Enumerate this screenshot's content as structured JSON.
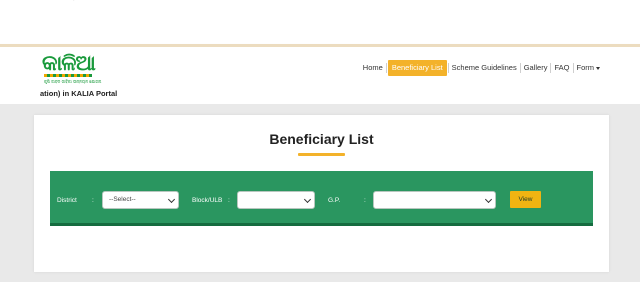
{
  "header": {
    "logo_text": "କାଳିଆ",
    "logo_tagline": "କୃଷି ଜୀବନ ଜୀବିକା ଉନ୍ନୟନ ଯୋଜନା",
    "portal_tagline": "ation) in KALIA Portal",
    "top_mark": "'"
  },
  "nav": {
    "items": [
      {
        "label": "Home",
        "active": false
      },
      {
        "label": "Beneficiary List",
        "active": true
      },
      {
        "label": "Scheme Guidelines",
        "active": false
      },
      {
        "label": "Gallery",
        "active": false
      },
      {
        "label": "FAQ",
        "active": false
      },
      {
        "label": "Form",
        "active": false,
        "has_dropdown": true
      }
    ],
    "active_color": "#f3b22a"
  },
  "page": {
    "title": "Beneficiary List"
  },
  "filters": {
    "district_label": "District",
    "district_value": "--Select--",
    "block_label": "Block/ULB",
    "block_value": "",
    "gp_label": "G.P.",
    "gp_value": "",
    "colon": ":",
    "view_label": "View"
  },
  "colors": {
    "brand_green": "#1a9a3c",
    "filter_bar": "#2a9660",
    "accent_yellow": "#f3b22a",
    "page_background": "#e9e9e9"
  }
}
